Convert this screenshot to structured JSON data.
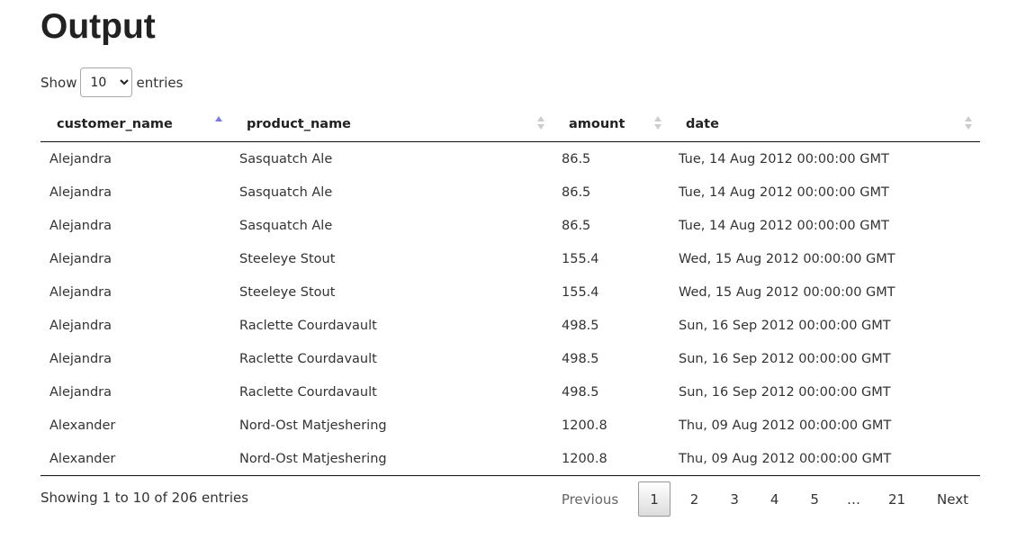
{
  "page_title": "Output",
  "length": {
    "show_label": "Show",
    "selected": "10",
    "entries_label": "entries"
  },
  "table": {
    "columns": [
      {
        "label": "customer_name",
        "sort": "asc"
      },
      {
        "label": "product_name",
        "sort": "none"
      },
      {
        "label": "amount",
        "sort": "none"
      },
      {
        "label": "date",
        "sort": "none"
      }
    ],
    "rows": [
      [
        "Alejandra",
        "Sasquatch Ale",
        "86.5",
        "Tue, 14 Aug 2012 00:00:00 GMT"
      ],
      [
        "Alejandra",
        "Sasquatch Ale",
        "86.5",
        "Tue, 14 Aug 2012 00:00:00 GMT"
      ],
      [
        "Alejandra",
        "Sasquatch Ale",
        "86.5",
        "Tue, 14 Aug 2012 00:00:00 GMT"
      ],
      [
        "Alejandra",
        "Steeleye Stout",
        "155.4",
        "Wed, 15 Aug 2012 00:00:00 GMT"
      ],
      [
        "Alejandra",
        "Steeleye Stout",
        "155.4",
        "Wed, 15 Aug 2012 00:00:00 GMT"
      ],
      [
        "Alejandra",
        "Raclette Courdavault",
        "498.5",
        "Sun, 16 Sep 2012 00:00:00 GMT"
      ],
      [
        "Alejandra",
        "Raclette Courdavault",
        "498.5",
        "Sun, 16 Sep 2012 00:00:00 GMT"
      ],
      [
        "Alejandra",
        "Raclette Courdavault",
        "498.5",
        "Sun, 16 Sep 2012 00:00:00 GMT"
      ],
      [
        "Alexander",
        "Nord-Ost Matjeshering",
        "1200.8",
        "Thu, 09 Aug 2012 00:00:00 GMT"
      ],
      [
        "Alexander",
        "Nord-Ost Matjeshering",
        "1200.8",
        "Thu, 09 Aug 2012 00:00:00 GMT"
      ]
    ]
  },
  "info_text": "Showing 1 to 10 of 206 entries",
  "pagination": {
    "previous": "Previous",
    "pages": [
      "1",
      "2",
      "3",
      "4",
      "5",
      "…",
      "21"
    ],
    "current": "1",
    "next": "Next"
  },
  "colors": {
    "sort_active": "#7c7cd8",
    "sort_inactive": "#cccccc"
  }
}
